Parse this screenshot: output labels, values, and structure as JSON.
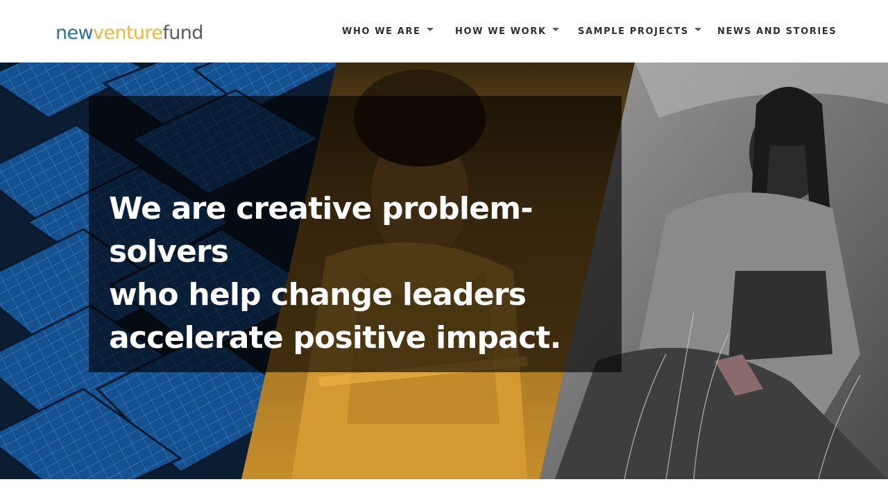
{
  "logo": {
    "part1": "new",
    "part2": "venture",
    "part3": "fund"
  },
  "nav": {
    "items": [
      {
        "label": "WHO WE ARE",
        "has_dropdown": true
      },
      {
        "label": "HOW WE WORK",
        "has_dropdown": true
      },
      {
        "label": "SAMPLE PROJECTS",
        "has_dropdown": true
      },
      {
        "label": "NEWS AND STORIES",
        "has_dropdown": false
      }
    ]
  },
  "hero": {
    "headline_line1": "We are creative problem-solvers",
    "headline_line2": "who help change leaders",
    "headline_line3": "accelerate positive impact.",
    "images": [
      {
        "name": "solar-panels-photo",
        "tint": "#1a5fa8"
      },
      {
        "name": "woman-portrait-photo",
        "tint": "#e0a233"
      },
      {
        "name": "gardener-woman-photo",
        "tint": "#7a7a7a"
      }
    ]
  },
  "colors": {
    "brand_blue": "#2a6f9a",
    "brand_gold": "#f0b53b",
    "brand_gray": "#5a5a5a"
  }
}
